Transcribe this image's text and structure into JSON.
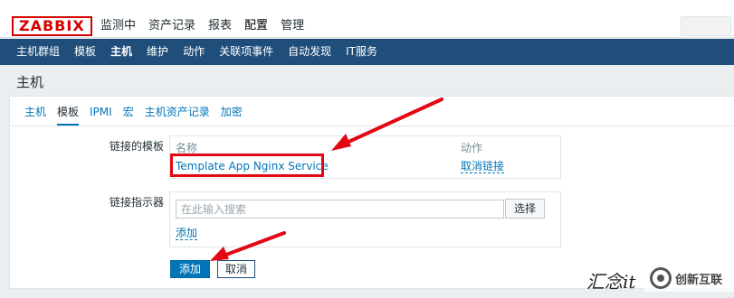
{
  "topbar": {
    "logo": "ZABBIX",
    "menu": [
      "监测中",
      "资产记录",
      "报表",
      "配置",
      "管理"
    ],
    "active_menu": "配置"
  },
  "subnav": {
    "items": [
      "主机群组",
      "模板",
      "主机",
      "维护",
      "动作",
      "关联项事件",
      "自动发现",
      "IT服务"
    ],
    "active": "主机"
  },
  "page": {
    "title": "主机"
  },
  "tabs": {
    "items": [
      "主机",
      "模板",
      "IPMI",
      "宏",
      "主机资产记录",
      "加密"
    ],
    "active": "模板"
  },
  "form": {
    "linked_templates_label": "链接的模板",
    "linked_templates": {
      "col_name": "名称",
      "col_action": "动作",
      "rows": [
        {
          "name": "Template App Nginx Service",
          "action": "取消链接"
        }
      ]
    },
    "link_indicator_label": "链接指示器",
    "search_placeholder": "在此输入搜索",
    "select_label": "选择",
    "add_link_label": "添加",
    "add_button": "添加",
    "cancel_button": "取消"
  },
  "watermark": {
    "text": "汇念it",
    "brand": "创新互联"
  },
  "colors": {
    "nav_bg": "#1f4e7a",
    "link": "#0275b8",
    "highlight": "#e30613",
    "logo_red": "#d40000"
  }
}
